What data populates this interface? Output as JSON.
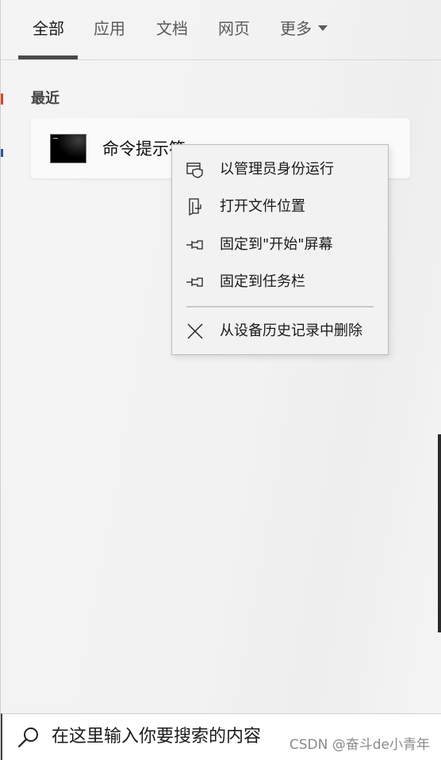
{
  "tabs": [
    {
      "label": "全部",
      "active": true
    },
    {
      "label": "应用",
      "active": false
    },
    {
      "label": "文档",
      "active": false
    },
    {
      "label": "网页",
      "active": false
    },
    {
      "label": "更多",
      "active": false
    }
  ],
  "recent": {
    "title": "最近",
    "items": [
      {
        "name": "命令提示符",
        "icon": "command-prompt-icon"
      }
    ]
  },
  "context_menu": {
    "items": [
      {
        "label": "以管理员身份运行",
        "icon": "shield-run-icon"
      },
      {
        "label": "打开文件位置",
        "icon": "file-location-icon"
      },
      {
        "label": "固定到\"开始\"屏幕",
        "icon": "pin-icon"
      },
      {
        "label": "固定到任务栏",
        "icon": "pin-icon"
      },
      {
        "label": "从设备历史记录中删除",
        "icon": "close-icon"
      }
    ]
  },
  "search": {
    "value": "在这里输入你要搜索的内容",
    "icon": "search-icon"
  },
  "watermark": "CSDN @奋斗de小青年",
  "colors": {
    "background": "#f3f3f3",
    "menu_background": "#f2f2f2",
    "active_tab_underline": "#4a4a4a",
    "text": "#1a1a1a"
  }
}
